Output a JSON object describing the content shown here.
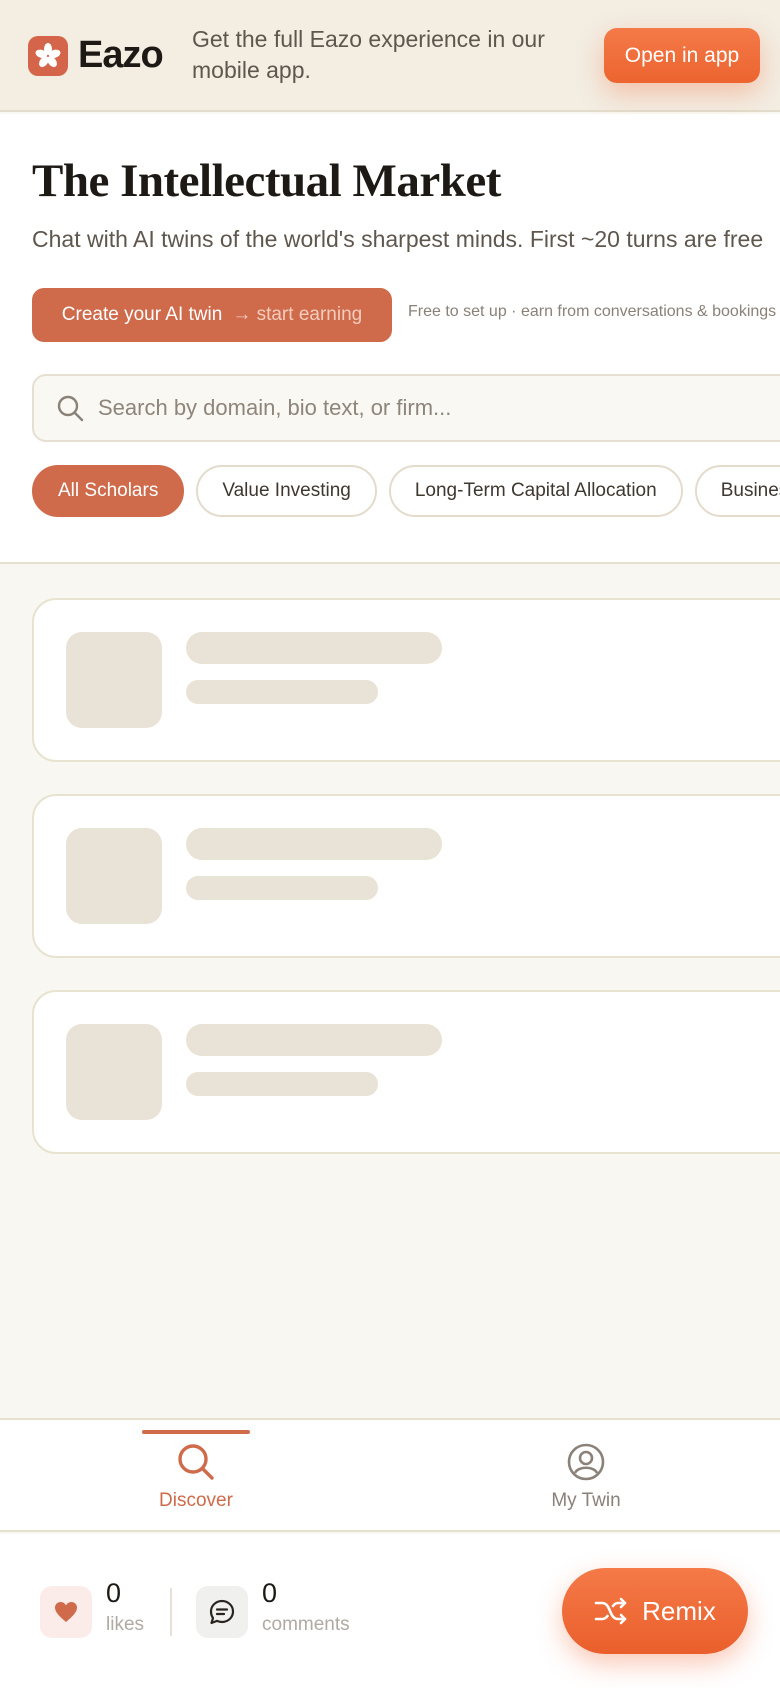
{
  "banner": {
    "brand": "Eazo",
    "message": "Get the full Eazo experience in our mobile app.",
    "open_button": "Open in app",
    "logo_icon": "asterisk-logo-icon"
  },
  "hero": {
    "title": "The Intellectual Market",
    "subtitle": "Chat with AI twins of the world's sharpest minds. First ~20 turns are free",
    "create_button": "Create your AI twin",
    "create_button_sub": "→ start earning",
    "setup_note": "Free to set up · earn from conversations & bookings"
  },
  "search": {
    "placeholder": "Search by domain, bio text, or firm...",
    "icon": "search-icon"
  },
  "filters": [
    {
      "label": "All Scholars",
      "active": true
    },
    {
      "label": "Value Investing",
      "active": false
    },
    {
      "label": "Long-Term Capital Allocation",
      "active": false
    },
    {
      "label": "Business",
      "active": false
    }
  ],
  "nav": {
    "discover": {
      "label": "Discover",
      "icon": "search-icon"
    },
    "my_twin": {
      "label": "My Twin",
      "icon": "user-circle-icon"
    }
  },
  "footer": {
    "likes_count": "0",
    "likes_label": "likes",
    "comments_count": "0",
    "comments_label": "comments",
    "remix_button": "Remix",
    "remix_icon": "shuffle-icon"
  },
  "colors": {
    "accent": "#cf6a4b",
    "cta_orange": "#ef6b35",
    "banner_bg": "#f3ede2",
    "page_bg": "#f9f7f2",
    "skeleton": "#e9e2d6"
  }
}
